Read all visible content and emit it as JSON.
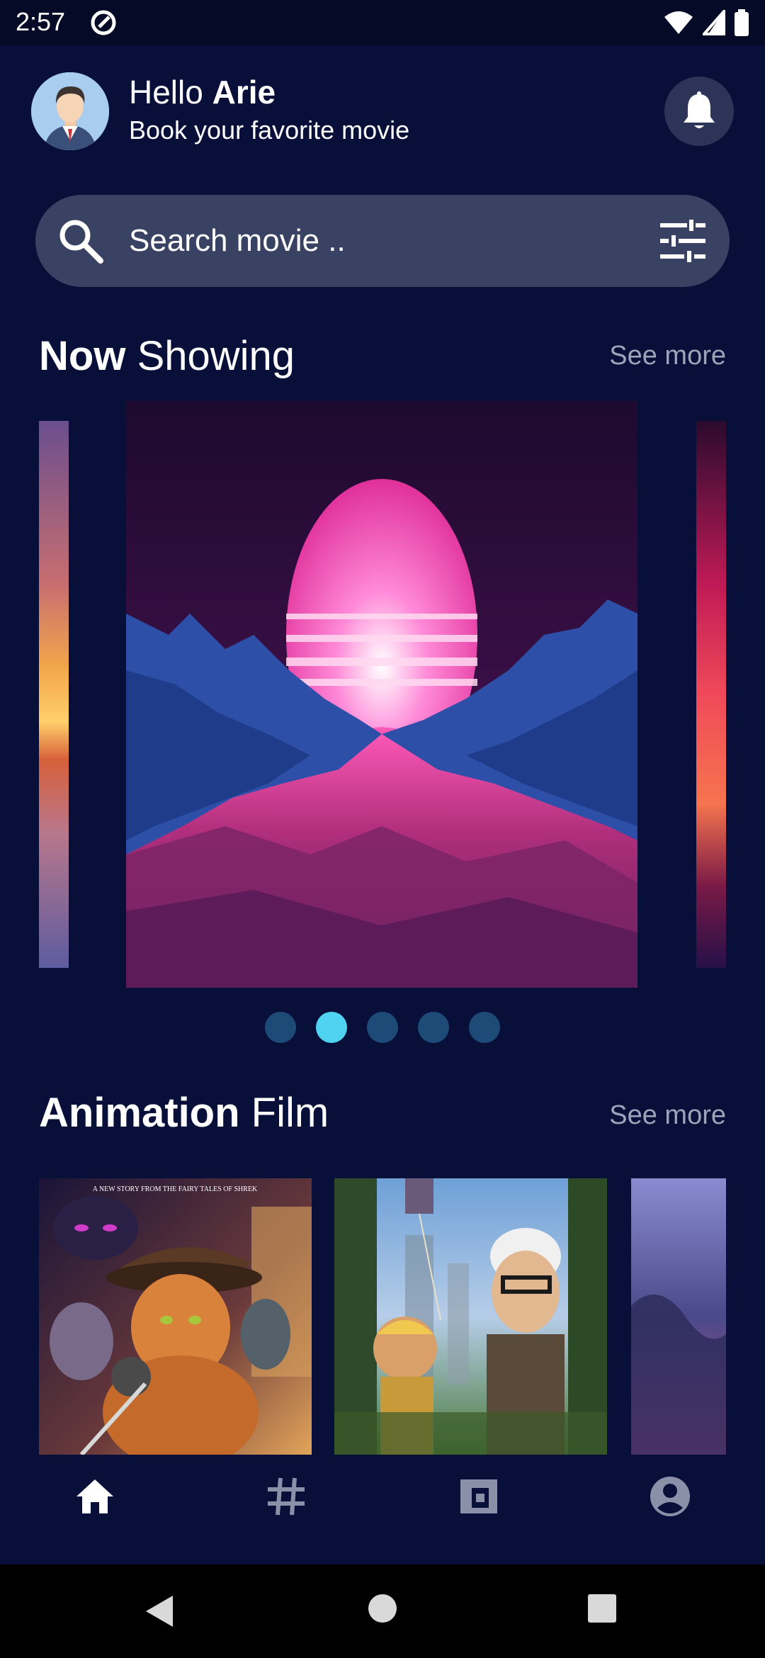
{
  "status_bar": {
    "time": "2:57",
    "icons": [
      "app-notification-icon",
      "wifi-icon",
      "signal-icon",
      "battery-icon"
    ]
  },
  "header": {
    "greeting_prefix": "Hello",
    "user_name": "Arie",
    "subtitle": "Book your favorite movie",
    "notification_icon": "bell-icon"
  },
  "search": {
    "placeholder": "Search movie ..",
    "value": "",
    "search_icon": "search-icon",
    "filter_icon": "tune-icon"
  },
  "now_showing": {
    "title_bold": "Now",
    "title_regular": "Showing",
    "see_more": "See more",
    "dots": 5,
    "active_dot_index": 1
  },
  "animation_film": {
    "title_bold": "Animation",
    "title_regular": "Film",
    "see_more": "See more",
    "poster_tagline": "A NEW STORY FROM THE FAIRY TALES OF SHREK"
  },
  "bottom_nav": {
    "items": [
      "home-icon",
      "hashtag-icon",
      "wallet-icon",
      "account-icon"
    ],
    "active_index": 0
  },
  "colors": {
    "background": "#08103a",
    "search_bar": "#3a4263",
    "see_more": "#9da3b8",
    "dot_active": "#4fd3f0",
    "dot_inactive": "#1d4a77"
  }
}
